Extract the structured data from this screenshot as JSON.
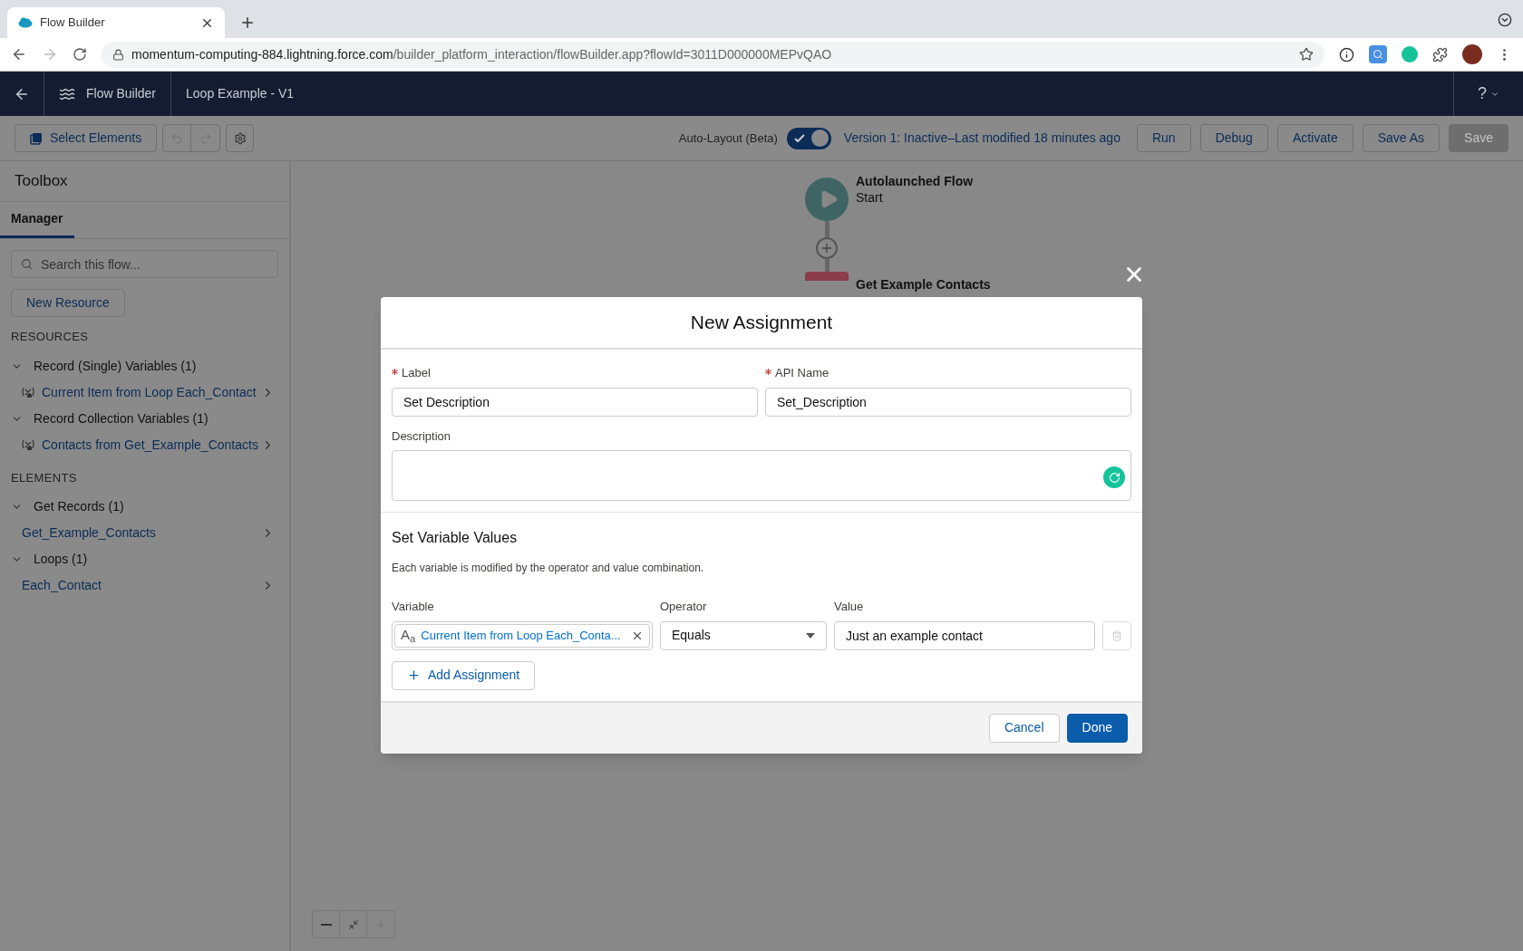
{
  "browser": {
    "tab_title": "Flow Builder",
    "url_host": "momentum-computing-884.lightning.force.com",
    "url_path": "/builder_platform_interaction/flowBuilder.app?flowId=3011D000000MEPvQAO"
  },
  "header": {
    "app_name": "Flow Builder",
    "flow_name": "Loop Example - V1",
    "help": "?"
  },
  "toolbar": {
    "select_elements": "Select Elements",
    "auto_layout": {
      "label": "Auto-Layout (Beta)",
      "on": true
    },
    "version": "Version 1: Inactive–Last modified 18 minutes ago",
    "buttons": [
      {
        "label": "Run",
        "disabled": false
      },
      {
        "label": "Debug",
        "disabled": false
      },
      {
        "label": "Activate",
        "disabled": false
      },
      {
        "label": "Save As",
        "disabled": false
      },
      {
        "label": "Save",
        "disabled": true
      }
    ]
  },
  "sidebar": {
    "title": "Toolbox",
    "tabs": [
      {
        "label": "Manager",
        "selected": true
      }
    ],
    "search": {
      "placeholder": "Search this flow..."
    },
    "new_resource": "New Resource",
    "sections": [
      {
        "heading": "RESOURCES",
        "groups": [
          {
            "label": "Record (Single) Variables (1)",
            "expanded": true,
            "children": [
              {
                "label": "Current Item from Loop Each_Contact",
                "kind": "variable"
              }
            ]
          },
          {
            "label": "Record Collection Variables (1)",
            "expanded": true,
            "children": [
              {
                "label": "Contacts from Get_Example_Contacts",
                "kind": "variable"
              }
            ]
          }
        ]
      },
      {
        "heading": "ELEMENTS",
        "groups": [
          {
            "label": "Get Records (1)",
            "expanded": true,
            "children": [
              {
                "label": "Get_Example_Contacts",
                "kind": "element"
              }
            ]
          },
          {
            "label": "Loops (1)",
            "expanded": true,
            "children": [
              {
                "label": "Each_Contact",
                "kind": "element"
              }
            ]
          }
        ]
      }
    ]
  },
  "canvas": {
    "start": {
      "title": "Autolaunched Flow",
      "subtitle": "Start"
    },
    "next_node": {
      "title": "Get Example Contacts"
    }
  },
  "modal": {
    "title": "New Assignment",
    "label_field": {
      "label": "Label",
      "required": true,
      "value": "Set Description"
    },
    "api_name_field": {
      "label": "API Name",
      "required": true,
      "value": "Set_Description"
    },
    "description_field": {
      "label": "Description"
    },
    "section_title": "Set Variable Values",
    "section_description": "Each variable is modified by the operator and value combination.",
    "columns": [
      "Variable",
      "Operator",
      "Value"
    ],
    "rows": [
      {
        "type_icon": "A$_{a}$",
        "variable": "Current Item from Loop Each_Conta...",
        "operator": "Equals",
        "value": "Just an example contact"
      }
    ],
    "add_assignment": "Add Assignment",
    "buttons": [
      {
        "label": "Cancel",
        "kind": "neutral"
      },
      {
        "label": "Done",
        "kind": "brand"
      }
    ]
  }
}
